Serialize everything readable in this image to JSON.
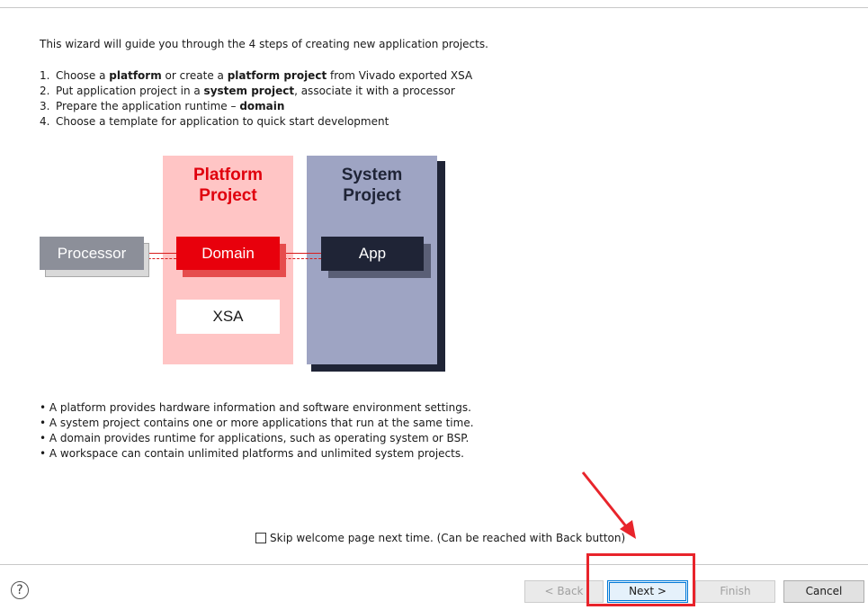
{
  "intro": "This wizard will guide you through the 4 steps of creating new application projects.",
  "steps": [
    {
      "num": "1.",
      "parts": [
        "Choose a ",
        "platform",
        " or create a ",
        "platform project",
        " from Vivado exported XSA"
      ]
    },
    {
      "num": "2.",
      "parts": [
        "Put application project in a ",
        "system project",
        ", associate it with a processor"
      ]
    },
    {
      "num": "3.",
      "parts": [
        "Prepare the application runtime – ",
        "domain",
        ""
      ]
    },
    {
      "num": "4.",
      "parts": [
        "Choose a template for application to quick start development"
      ]
    }
  ],
  "diagram": {
    "platform_project_title": [
      "Platform",
      "Project"
    ],
    "system_project_title": [
      "System",
      "Project"
    ],
    "processor": "Processor",
    "domain": "Domain",
    "app": "App",
    "xsa": "XSA",
    "colors": {
      "platform_bg": "#ffc5c5",
      "platform_title": "#e0000d",
      "domain": "#e8000c",
      "system_bg": "#9ea4c3",
      "system_dark": "#1f2436",
      "processor": "#8c8f99"
    }
  },
  "bullets": [
    "• A platform provides hardware information and software environment settings.",
    "• A system project contains one or more applications that run at the same time.",
    "• A domain provides runtime for applications, such as operating system or BSP.",
    "• A workspace can contain unlimited platforms and unlimited system projects."
  ],
  "skip_checkbox": {
    "label": "Skip welcome page next time. (Can be reached with Back button)",
    "checked": false
  },
  "help_icon": "question-mark-icon",
  "buttons": {
    "back": "< Back",
    "next": "Next >",
    "finish": "Finish",
    "cancel": "Cancel"
  },
  "annotation_color": "#e8242b"
}
